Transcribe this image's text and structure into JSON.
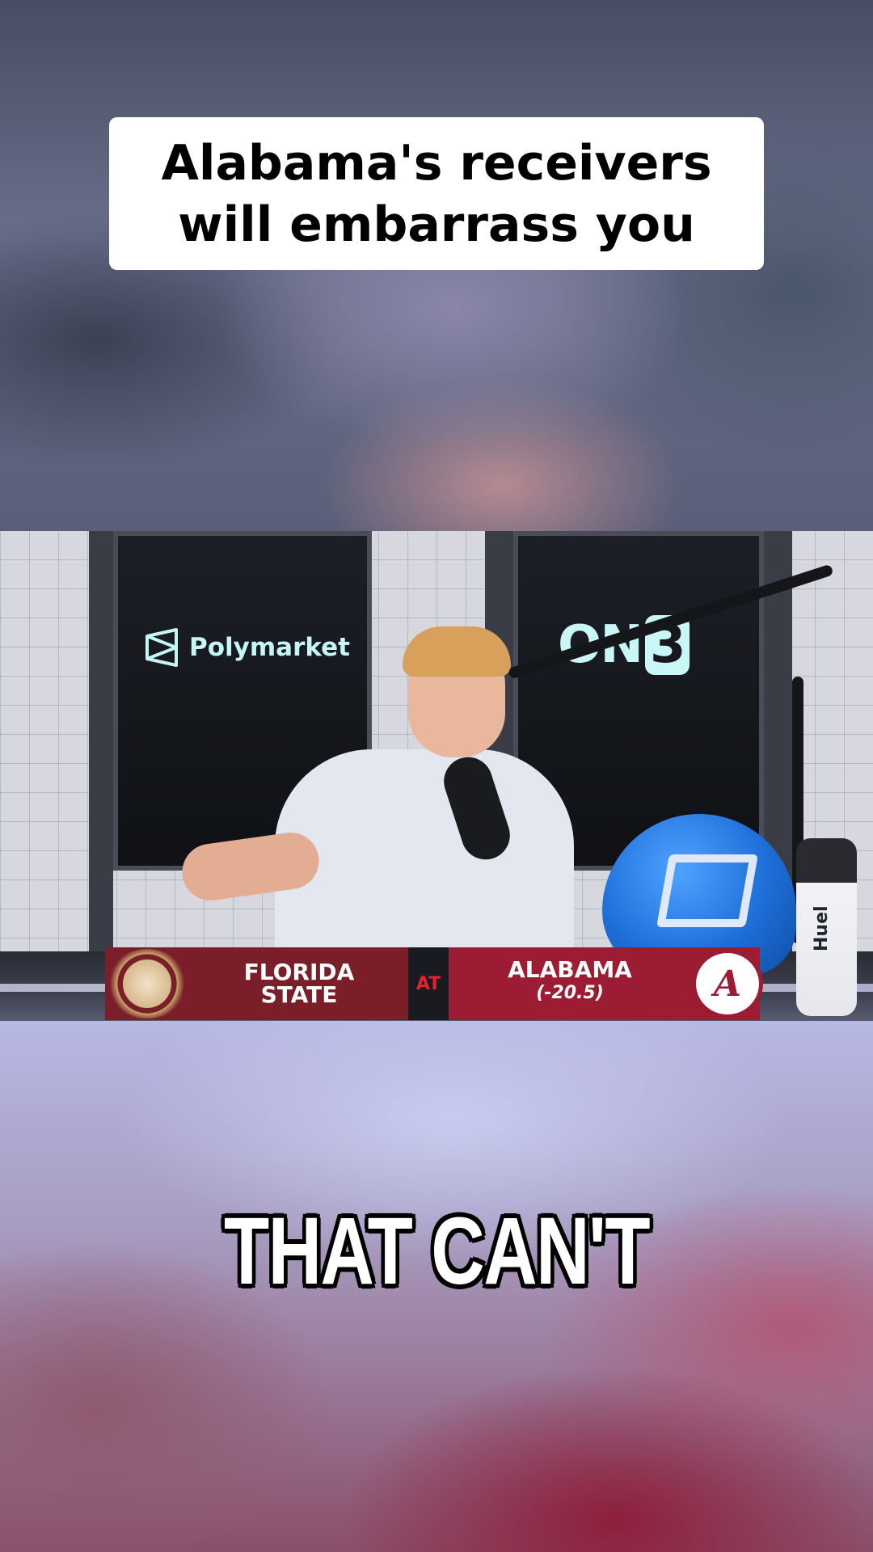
{
  "headline": {
    "text": "Alabama's receivers will embarrass you"
  },
  "video": {
    "sponsor_logo_text": "Polymarket",
    "network_logo_text_a": "ON",
    "network_logo_text_b": "3",
    "bottle_brand": "Huel",
    "scoreboard": {
      "away_team_line1": "FLORIDA",
      "away_team_line2": "STATE",
      "separator": "AT",
      "home_team": "ALABAMA",
      "home_spread": "(-20.5)",
      "home_logo_letter": "A"
    }
  },
  "caption": {
    "text": "THAT CAN'T"
  },
  "colors": {
    "fsu_garnet": "#7a1f2a",
    "bama_crimson": "#9b1c33",
    "logo_teal": "#c6f5f5"
  }
}
